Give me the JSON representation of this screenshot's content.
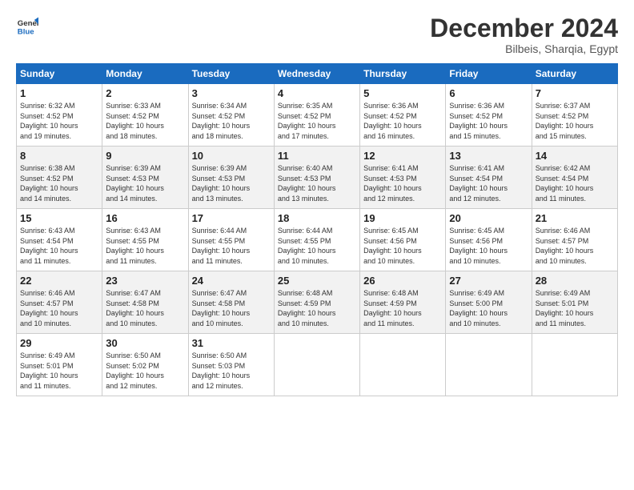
{
  "logo": {
    "line1": "General",
    "line2": "Blue"
  },
  "calendar": {
    "title": "December 2024",
    "subtitle": "Bilbeis, Sharqia, Egypt"
  },
  "headers": [
    "Sunday",
    "Monday",
    "Tuesday",
    "Wednesday",
    "Thursday",
    "Friday",
    "Saturday"
  ],
  "weeks": [
    [
      {
        "day": "1",
        "info": "Sunrise: 6:32 AM\nSunset: 4:52 PM\nDaylight: 10 hours\nand 19 minutes."
      },
      {
        "day": "2",
        "info": "Sunrise: 6:33 AM\nSunset: 4:52 PM\nDaylight: 10 hours\nand 18 minutes."
      },
      {
        "day": "3",
        "info": "Sunrise: 6:34 AM\nSunset: 4:52 PM\nDaylight: 10 hours\nand 18 minutes."
      },
      {
        "day": "4",
        "info": "Sunrise: 6:35 AM\nSunset: 4:52 PM\nDaylight: 10 hours\nand 17 minutes."
      },
      {
        "day": "5",
        "info": "Sunrise: 6:36 AM\nSunset: 4:52 PM\nDaylight: 10 hours\nand 16 minutes."
      },
      {
        "day": "6",
        "info": "Sunrise: 6:36 AM\nSunset: 4:52 PM\nDaylight: 10 hours\nand 15 minutes."
      },
      {
        "day": "7",
        "info": "Sunrise: 6:37 AM\nSunset: 4:52 PM\nDaylight: 10 hours\nand 15 minutes."
      }
    ],
    [
      {
        "day": "8",
        "info": "Sunrise: 6:38 AM\nSunset: 4:52 PM\nDaylight: 10 hours\nand 14 minutes."
      },
      {
        "day": "9",
        "info": "Sunrise: 6:39 AM\nSunset: 4:53 PM\nDaylight: 10 hours\nand 14 minutes."
      },
      {
        "day": "10",
        "info": "Sunrise: 6:39 AM\nSunset: 4:53 PM\nDaylight: 10 hours\nand 13 minutes."
      },
      {
        "day": "11",
        "info": "Sunrise: 6:40 AM\nSunset: 4:53 PM\nDaylight: 10 hours\nand 13 minutes."
      },
      {
        "day": "12",
        "info": "Sunrise: 6:41 AM\nSunset: 4:53 PM\nDaylight: 10 hours\nand 12 minutes."
      },
      {
        "day": "13",
        "info": "Sunrise: 6:41 AM\nSunset: 4:54 PM\nDaylight: 10 hours\nand 12 minutes."
      },
      {
        "day": "14",
        "info": "Sunrise: 6:42 AM\nSunset: 4:54 PM\nDaylight: 10 hours\nand 11 minutes."
      }
    ],
    [
      {
        "day": "15",
        "info": "Sunrise: 6:43 AM\nSunset: 4:54 PM\nDaylight: 10 hours\nand 11 minutes."
      },
      {
        "day": "16",
        "info": "Sunrise: 6:43 AM\nSunset: 4:55 PM\nDaylight: 10 hours\nand 11 minutes."
      },
      {
        "day": "17",
        "info": "Sunrise: 6:44 AM\nSunset: 4:55 PM\nDaylight: 10 hours\nand 11 minutes."
      },
      {
        "day": "18",
        "info": "Sunrise: 6:44 AM\nSunset: 4:55 PM\nDaylight: 10 hours\nand 10 minutes."
      },
      {
        "day": "19",
        "info": "Sunrise: 6:45 AM\nSunset: 4:56 PM\nDaylight: 10 hours\nand 10 minutes."
      },
      {
        "day": "20",
        "info": "Sunrise: 6:45 AM\nSunset: 4:56 PM\nDaylight: 10 hours\nand 10 minutes."
      },
      {
        "day": "21",
        "info": "Sunrise: 6:46 AM\nSunset: 4:57 PM\nDaylight: 10 hours\nand 10 minutes."
      }
    ],
    [
      {
        "day": "22",
        "info": "Sunrise: 6:46 AM\nSunset: 4:57 PM\nDaylight: 10 hours\nand 10 minutes."
      },
      {
        "day": "23",
        "info": "Sunrise: 6:47 AM\nSunset: 4:58 PM\nDaylight: 10 hours\nand 10 minutes."
      },
      {
        "day": "24",
        "info": "Sunrise: 6:47 AM\nSunset: 4:58 PM\nDaylight: 10 hours\nand 10 minutes."
      },
      {
        "day": "25",
        "info": "Sunrise: 6:48 AM\nSunset: 4:59 PM\nDaylight: 10 hours\nand 10 minutes."
      },
      {
        "day": "26",
        "info": "Sunrise: 6:48 AM\nSunset: 4:59 PM\nDaylight: 10 hours\nand 11 minutes."
      },
      {
        "day": "27",
        "info": "Sunrise: 6:49 AM\nSunset: 5:00 PM\nDaylight: 10 hours\nand 10 minutes."
      },
      {
        "day": "28",
        "info": "Sunrise: 6:49 AM\nSunset: 5:01 PM\nDaylight: 10 hours\nand 11 minutes."
      }
    ],
    [
      {
        "day": "29",
        "info": "Sunrise: 6:49 AM\nSunset: 5:01 PM\nDaylight: 10 hours\nand 11 minutes."
      },
      {
        "day": "30",
        "info": "Sunrise: 6:50 AM\nSunset: 5:02 PM\nDaylight: 10 hours\nand 12 minutes."
      },
      {
        "day": "31",
        "info": "Sunrise: 6:50 AM\nSunset: 5:03 PM\nDaylight: 10 hours\nand 12 minutes."
      },
      null,
      null,
      null,
      null
    ]
  ]
}
